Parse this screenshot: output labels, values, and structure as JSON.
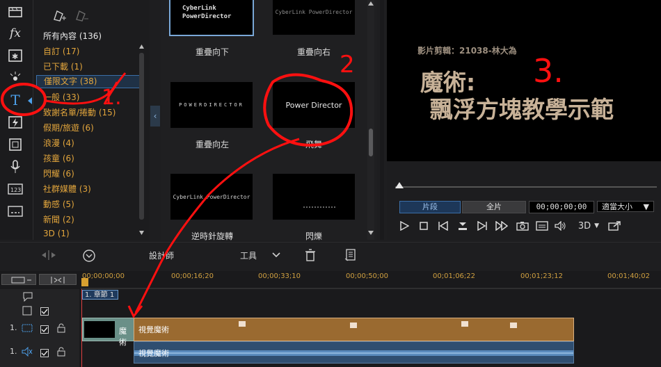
{
  "categories": {
    "all": "所有內容 (136)",
    "items": [
      "自訂 (17)",
      "已下載 (1)",
      "僅限文字 (38)",
      "一般 (33)",
      "致謝名單/捲動 (15)",
      "假期/旅遊 (6)",
      "浪漫 (4)",
      "孩童 (6)",
      "閃耀 (6)",
      "社群媒體 (3)",
      "動感 (5)",
      "新聞 (2)",
      "3D (1)"
    ]
  },
  "thumbnails": {
    "t1_text": "CyberLink PowerDirector",
    "t1_label": "重疊向下",
    "t2_text": "CyberLink PowerDirector",
    "t2_label": "重疊向右",
    "t3_text": "POWERDIRECTOR",
    "t3_label": "重疊向左",
    "t4_text": "Power Director",
    "t4_label": "飛舞",
    "t5_text": "CyberLink PowerDirector",
    "t5_label": "逆時針旋轉",
    "t6_label": "閃爍"
  },
  "preview": {
    "credit": "影片剪輯：21038-林大為",
    "title_line1": "魔術:",
    "title_line2": "飄浮方塊教學示範",
    "tab_clip": "片段",
    "tab_movie": "全片",
    "timecode": "00;00;00;00",
    "fit": "適當大小",
    "mode3d": "3D"
  },
  "editbar": {
    "designer": "設計師",
    "tools": "工具"
  },
  "timeline": {
    "ticks": [
      "00;00;00;00",
      "00;00;16;20",
      "00;00;33;10",
      "00;00;50;00",
      "00;01;06;22",
      "00;01;23;12",
      "00;01;40;02"
    ],
    "chapter": "1. 章節 1",
    "track1_num": "1.",
    "track2_num": "1.",
    "title_clip": "魔術",
    "video_clip": "視覺魔術",
    "audio_clip": "視覺魔術"
  },
  "annotations": {
    "n1": "1.",
    "n2": "2",
    "n3": "3."
  },
  "colors": {
    "accent_orange": "#e2a53c",
    "select_blue": "#3b6fa8",
    "annotation_red": "#ff1010"
  }
}
